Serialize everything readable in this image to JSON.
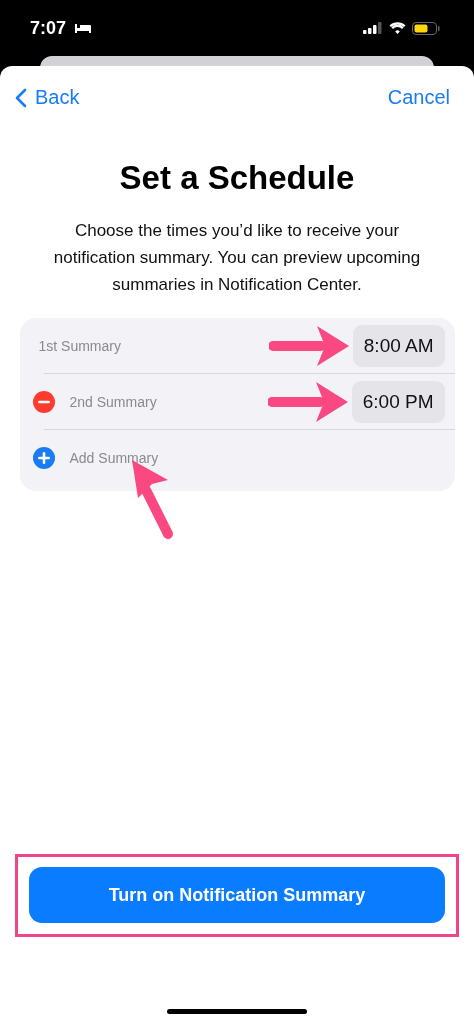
{
  "status_bar": {
    "time": "7:07"
  },
  "nav": {
    "back": "Back",
    "cancel": "Cancel"
  },
  "title": "Set a Schedule",
  "description": "Choose the times you’d like to receive your notification summary. You can preview upcoming summaries in Notification Center.",
  "summaries": [
    {
      "kind": "time",
      "label": "1st Summary",
      "time": "8:00 AM"
    },
    {
      "kind": "removable",
      "label": "2nd Summary",
      "time": "6:00 PM"
    },
    {
      "kind": "add",
      "label": "Add Summary"
    }
  ],
  "primary_button": {
    "label": "Turn on Notification Summary"
  }
}
